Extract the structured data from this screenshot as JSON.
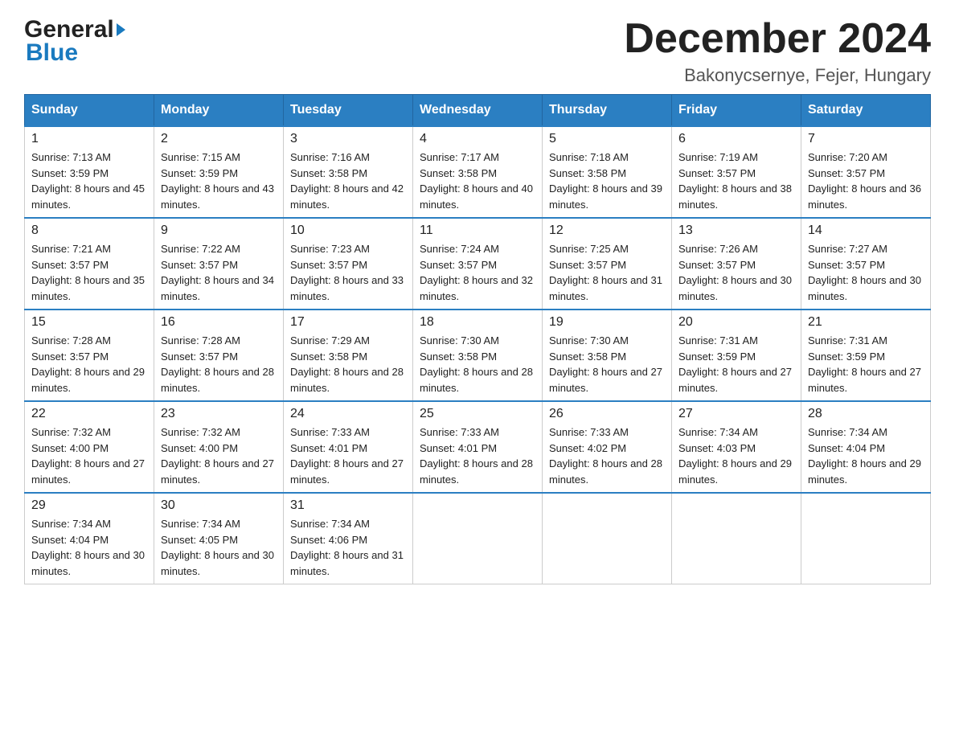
{
  "header": {
    "logo_general": "General",
    "logo_blue": "Blue",
    "month_title": "December 2024",
    "location": "Bakonycsernye, Fejer, Hungary"
  },
  "weekdays": [
    "Sunday",
    "Monday",
    "Tuesday",
    "Wednesday",
    "Thursday",
    "Friday",
    "Saturday"
  ],
  "weeks": [
    [
      {
        "day": "1",
        "sunrise": "7:13 AM",
        "sunset": "3:59 PM",
        "daylight": "8 hours and 45 minutes."
      },
      {
        "day": "2",
        "sunrise": "7:15 AM",
        "sunset": "3:59 PM",
        "daylight": "8 hours and 43 minutes."
      },
      {
        "day": "3",
        "sunrise": "7:16 AM",
        "sunset": "3:58 PM",
        "daylight": "8 hours and 42 minutes."
      },
      {
        "day": "4",
        "sunrise": "7:17 AM",
        "sunset": "3:58 PM",
        "daylight": "8 hours and 40 minutes."
      },
      {
        "day": "5",
        "sunrise": "7:18 AM",
        "sunset": "3:58 PM",
        "daylight": "8 hours and 39 minutes."
      },
      {
        "day": "6",
        "sunrise": "7:19 AM",
        "sunset": "3:57 PM",
        "daylight": "8 hours and 38 minutes."
      },
      {
        "day": "7",
        "sunrise": "7:20 AM",
        "sunset": "3:57 PM",
        "daylight": "8 hours and 36 minutes."
      }
    ],
    [
      {
        "day": "8",
        "sunrise": "7:21 AM",
        "sunset": "3:57 PM",
        "daylight": "8 hours and 35 minutes."
      },
      {
        "day": "9",
        "sunrise": "7:22 AM",
        "sunset": "3:57 PM",
        "daylight": "8 hours and 34 minutes."
      },
      {
        "day": "10",
        "sunrise": "7:23 AM",
        "sunset": "3:57 PM",
        "daylight": "8 hours and 33 minutes."
      },
      {
        "day": "11",
        "sunrise": "7:24 AM",
        "sunset": "3:57 PM",
        "daylight": "8 hours and 32 minutes."
      },
      {
        "day": "12",
        "sunrise": "7:25 AM",
        "sunset": "3:57 PM",
        "daylight": "8 hours and 31 minutes."
      },
      {
        "day": "13",
        "sunrise": "7:26 AM",
        "sunset": "3:57 PM",
        "daylight": "8 hours and 30 minutes."
      },
      {
        "day": "14",
        "sunrise": "7:27 AM",
        "sunset": "3:57 PM",
        "daylight": "8 hours and 30 minutes."
      }
    ],
    [
      {
        "day": "15",
        "sunrise": "7:28 AM",
        "sunset": "3:57 PM",
        "daylight": "8 hours and 29 minutes."
      },
      {
        "day": "16",
        "sunrise": "7:28 AM",
        "sunset": "3:57 PM",
        "daylight": "8 hours and 28 minutes."
      },
      {
        "day": "17",
        "sunrise": "7:29 AM",
        "sunset": "3:58 PM",
        "daylight": "8 hours and 28 minutes."
      },
      {
        "day": "18",
        "sunrise": "7:30 AM",
        "sunset": "3:58 PM",
        "daylight": "8 hours and 28 minutes."
      },
      {
        "day": "19",
        "sunrise": "7:30 AM",
        "sunset": "3:58 PM",
        "daylight": "8 hours and 27 minutes."
      },
      {
        "day": "20",
        "sunrise": "7:31 AM",
        "sunset": "3:59 PM",
        "daylight": "8 hours and 27 minutes."
      },
      {
        "day": "21",
        "sunrise": "7:31 AM",
        "sunset": "3:59 PM",
        "daylight": "8 hours and 27 minutes."
      }
    ],
    [
      {
        "day": "22",
        "sunrise": "7:32 AM",
        "sunset": "4:00 PM",
        "daylight": "8 hours and 27 minutes."
      },
      {
        "day": "23",
        "sunrise": "7:32 AM",
        "sunset": "4:00 PM",
        "daylight": "8 hours and 27 minutes."
      },
      {
        "day": "24",
        "sunrise": "7:33 AM",
        "sunset": "4:01 PM",
        "daylight": "8 hours and 27 minutes."
      },
      {
        "day": "25",
        "sunrise": "7:33 AM",
        "sunset": "4:01 PM",
        "daylight": "8 hours and 28 minutes."
      },
      {
        "day": "26",
        "sunrise": "7:33 AM",
        "sunset": "4:02 PM",
        "daylight": "8 hours and 28 minutes."
      },
      {
        "day": "27",
        "sunrise": "7:34 AM",
        "sunset": "4:03 PM",
        "daylight": "8 hours and 29 minutes."
      },
      {
        "day": "28",
        "sunrise": "7:34 AM",
        "sunset": "4:04 PM",
        "daylight": "8 hours and 29 minutes."
      }
    ],
    [
      {
        "day": "29",
        "sunrise": "7:34 AM",
        "sunset": "4:04 PM",
        "daylight": "8 hours and 30 minutes."
      },
      {
        "day": "30",
        "sunrise": "7:34 AM",
        "sunset": "4:05 PM",
        "daylight": "8 hours and 30 minutes."
      },
      {
        "day": "31",
        "sunrise": "7:34 AM",
        "sunset": "4:06 PM",
        "daylight": "8 hours and 31 minutes."
      },
      null,
      null,
      null,
      null
    ]
  ]
}
